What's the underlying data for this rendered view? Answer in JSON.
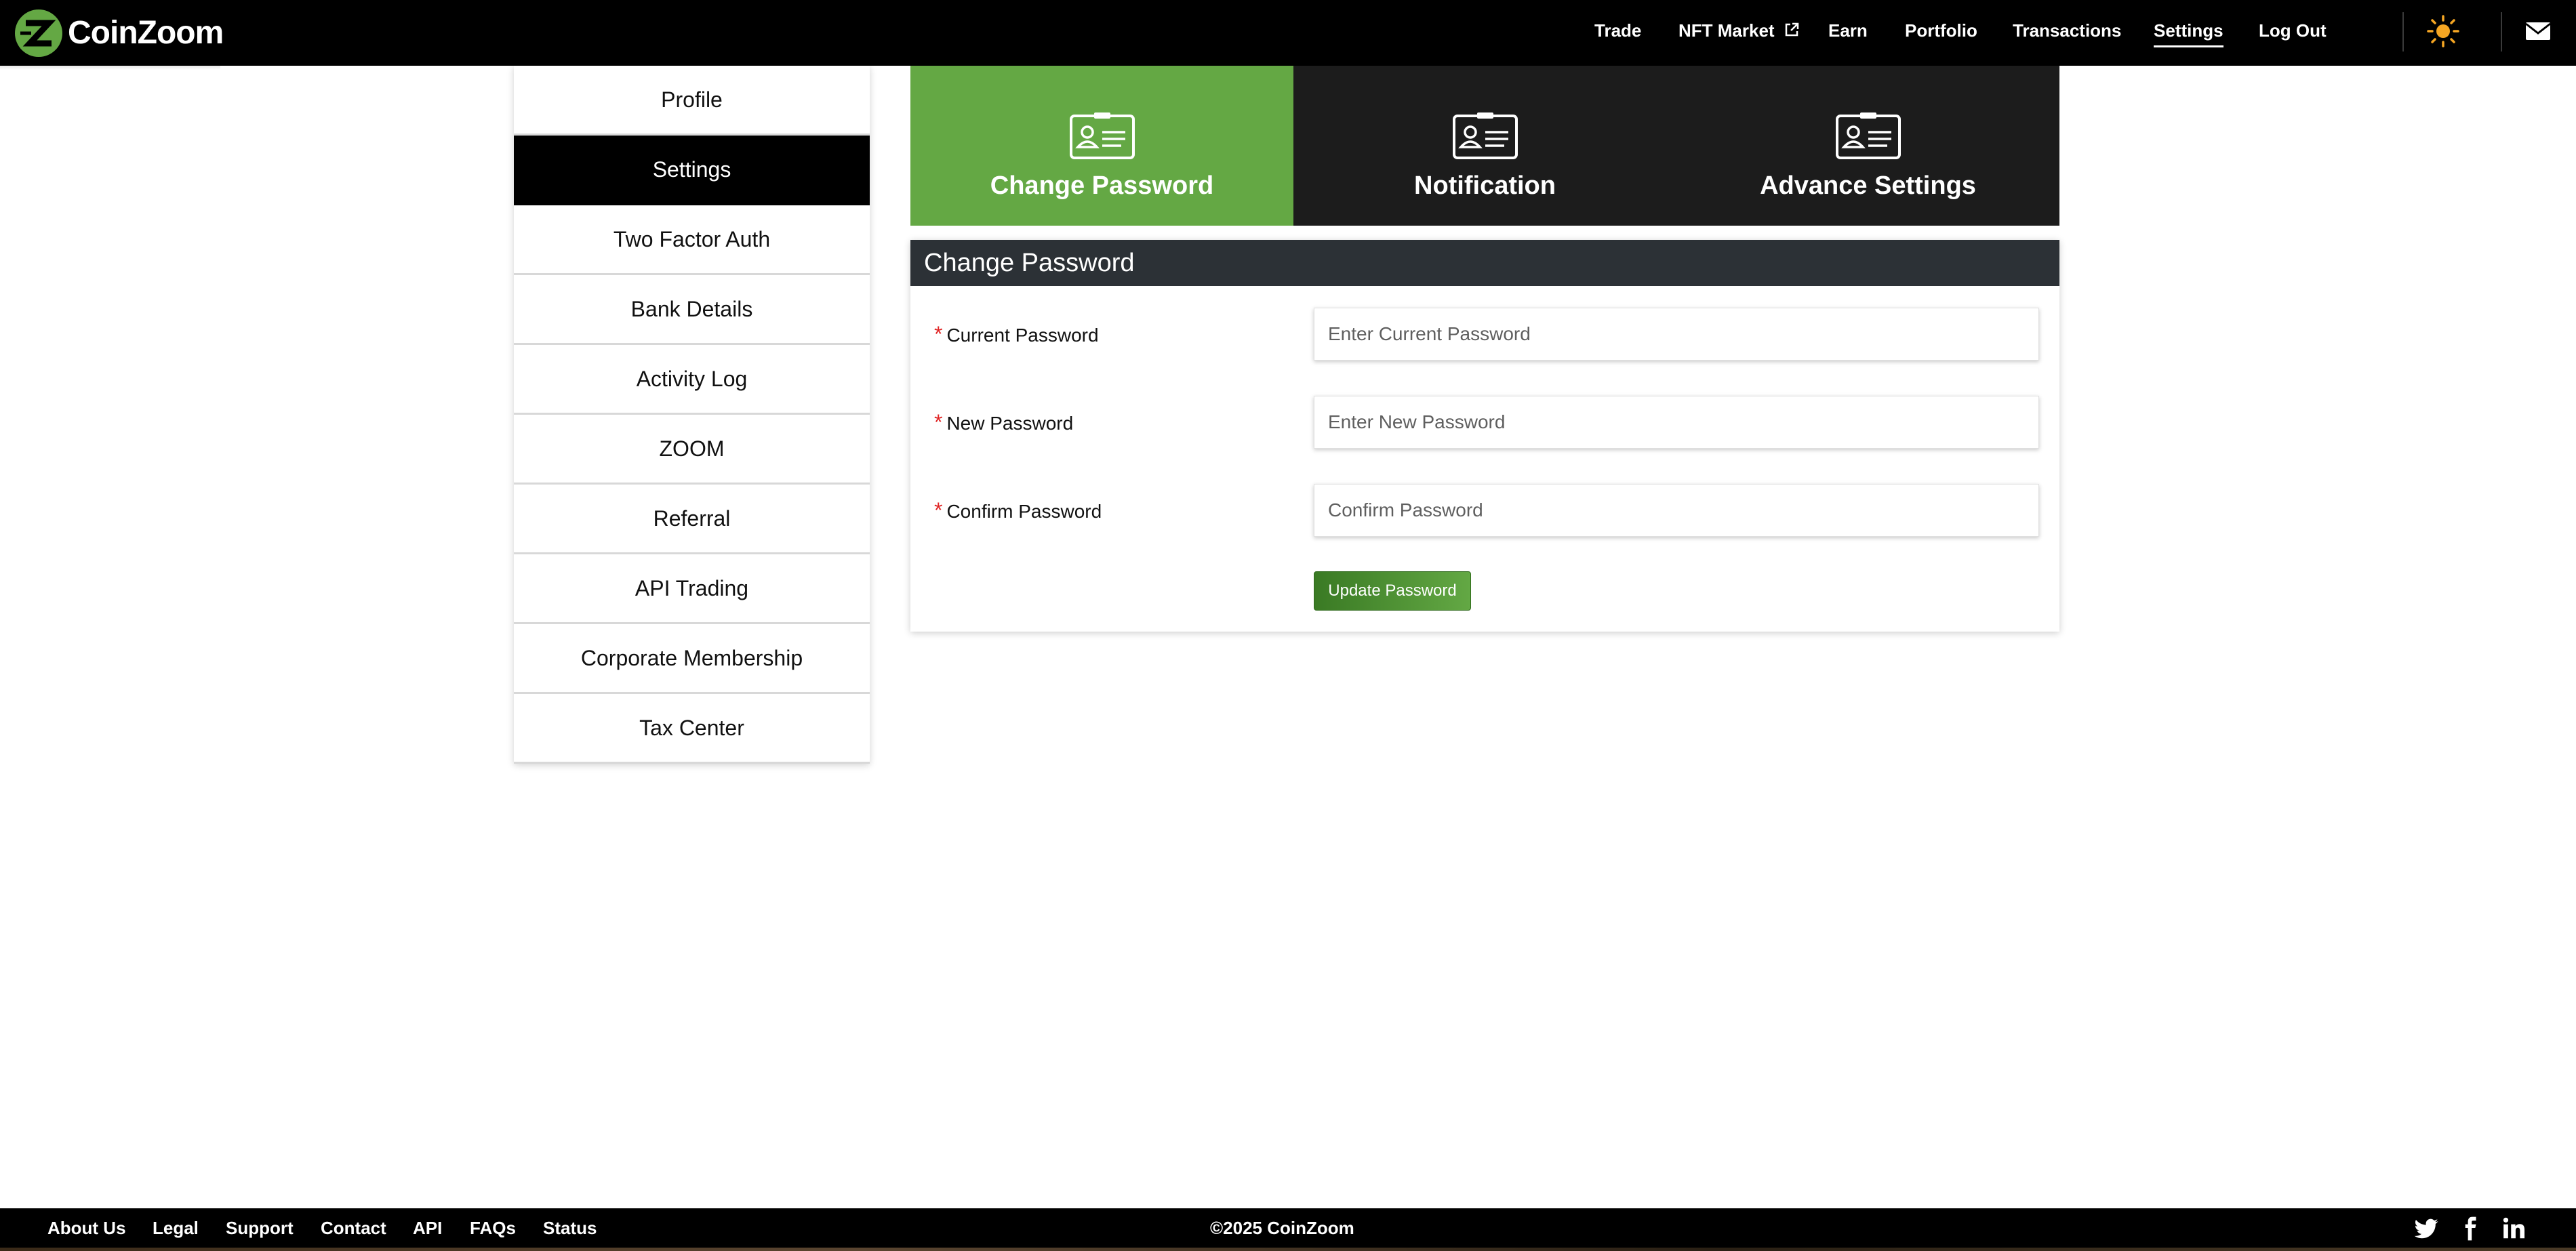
{
  "app": {
    "brand": "CoinZoom",
    "brand_color": "#64a844"
  },
  "nav": {
    "items": [
      {
        "label": "Trade"
      },
      {
        "label": "NFT Market",
        "icon": "external-link-icon"
      },
      {
        "label": "Earn"
      },
      {
        "label": "Portfolio"
      },
      {
        "label": "Transactions"
      },
      {
        "label": "Settings",
        "active": true
      },
      {
        "label": "Log Out"
      }
    ],
    "theme_icon": "sun-icon",
    "mail_icon": "envelope-icon"
  },
  "sidebar": {
    "items": [
      {
        "label": "Profile"
      },
      {
        "label": "Settings",
        "active": true
      },
      {
        "label": "Two Factor Auth"
      },
      {
        "label": "Bank Details"
      },
      {
        "label": "Activity Log"
      },
      {
        "label": "ZOOM"
      },
      {
        "label": "Referral"
      },
      {
        "label": "API Trading"
      },
      {
        "label": "Corporate Membership"
      },
      {
        "label": "Tax Center"
      }
    ]
  },
  "tabs": [
    {
      "label": "Change Password",
      "icon": "id-card-icon",
      "active": true
    },
    {
      "label": "Notification",
      "icon": "id-card-icon"
    },
    {
      "label": "Advance Settings",
      "icon": "id-card-icon"
    }
  ],
  "form": {
    "title": "Change Password",
    "required_mark": "*",
    "fields": [
      {
        "label": "Current Password",
        "placeholder": "Enter Current Password",
        "value": ""
      },
      {
        "label": "New Password",
        "placeholder": "Enter New Password",
        "value": ""
      },
      {
        "label": "Confirm Password",
        "placeholder": "Confirm Password",
        "value": ""
      }
    ],
    "submit_label": "Update Password"
  },
  "footer": {
    "links": [
      {
        "label": "About Us"
      },
      {
        "label": "Legal"
      },
      {
        "label": "Support"
      },
      {
        "label": "Contact"
      },
      {
        "label": "API"
      },
      {
        "label": "FAQs"
      },
      {
        "label": "Status"
      }
    ],
    "copyright": "©2025 CoinZoom",
    "social": [
      "twitter-icon",
      "facebook-icon",
      "linkedin-icon"
    ]
  }
}
